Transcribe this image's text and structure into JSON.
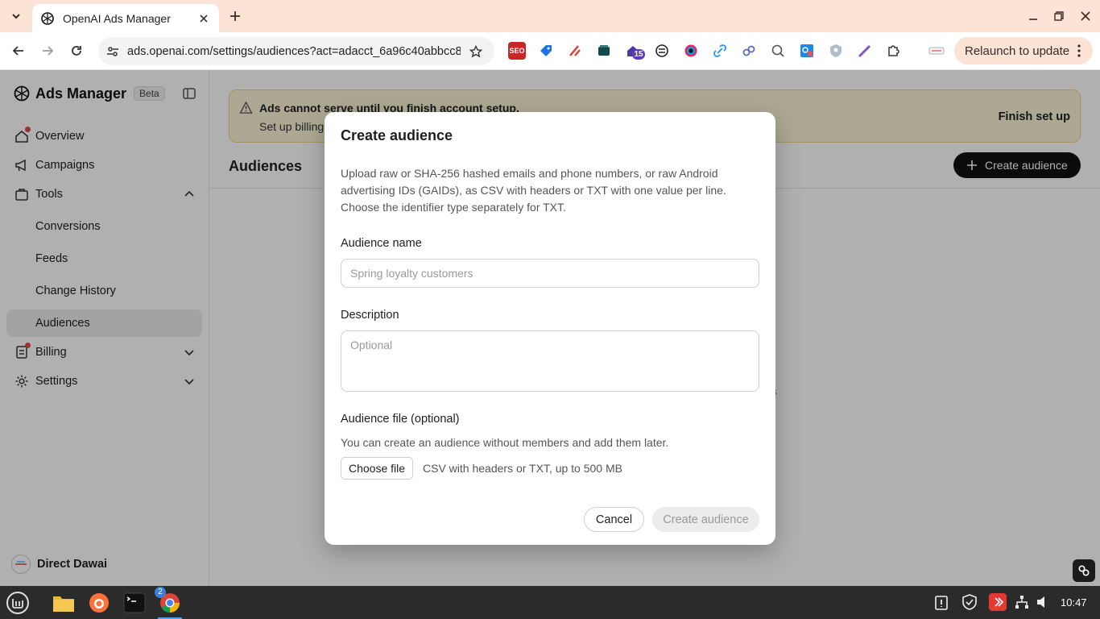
{
  "browser": {
    "tab_title": "OpenAI Ads Manager",
    "url": "ads.openai.com/settings/audiences?act=adacct_6a96c40abbcc8...",
    "relaunch_label": "Relaunch to update",
    "extension_badge": "15"
  },
  "sidebar": {
    "brand": "Ads Manager",
    "beta": "Beta",
    "items": [
      {
        "label": "Overview"
      },
      {
        "label": "Campaigns"
      },
      {
        "label": "Tools"
      },
      {
        "label": "Conversions"
      },
      {
        "label": "Feeds"
      },
      {
        "label": "Change History"
      },
      {
        "label": "Audiences"
      },
      {
        "label": "Billing"
      },
      {
        "label": "Settings"
      }
    ],
    "user_name": "Direct Dawai"
  },
  "banner": {
    "title": "Ads cannot serve until you finish account setup.",
    "body": "Set up billing",
    "action": "Finish set up"
  },
  "page": {
    "title": "Audiences",
    "create_label": "Create audience",
    "peek_text": "s"
  },
  "dialog": {
    "title": "Create audience",
    "description": "Upload raw or SHA-256 hashed emails and phone numbers, or raw Android advertising IDs (GAIDs), as CSV with headers or TXT with one value per line. Choose the identifier type separately for TXT.",
    "name_label": "Audience name",
    "name_placeholder": "Spring loyalty customers",
    "desc_label": "Description",
    "desc_placeholder": "Optional",
    "file_label": "Audience file (optional)",
    "file_help": "You can create an audience without members and add them later.",
    "choose_file": "Choose file",
    "file_note": "CSV with headers or TXT, up to 500 MB",
    "cancel": "Cancel",
    "submit": "Create audience"
  },
  "taskbar": {
    "chrome_badge": "2",
    "clock": "10:47"
  },
  "colors": {
    "tabstrip": "#fbe3d6",
    "banner_bg": "#fbf3d6",
    "primary_button": "#111111",
    "notification_dot": "#e5484d"
  },
  "icons": [
    "chevron-down-icon",
    "openai-logo-icon",
    "close-icon",
    "plus-icon",
    "minimize-icon",
    "restore-icon",
    "back-icon",
    "forward-icon",
    "reload-icon",
    "site-settings-icon",
    "star-icon",
    "puzzle-icon",
    "more-vert-icon",
    "sidebar-toggle-icon",
    "overview-icon",
    "campaigns-icon",
    "tools-icon",
    "billing-icon",
    "settings-icon",
    "chevron-up-icon",
    "warning-icon",
    "link-icon"
  ]
}
